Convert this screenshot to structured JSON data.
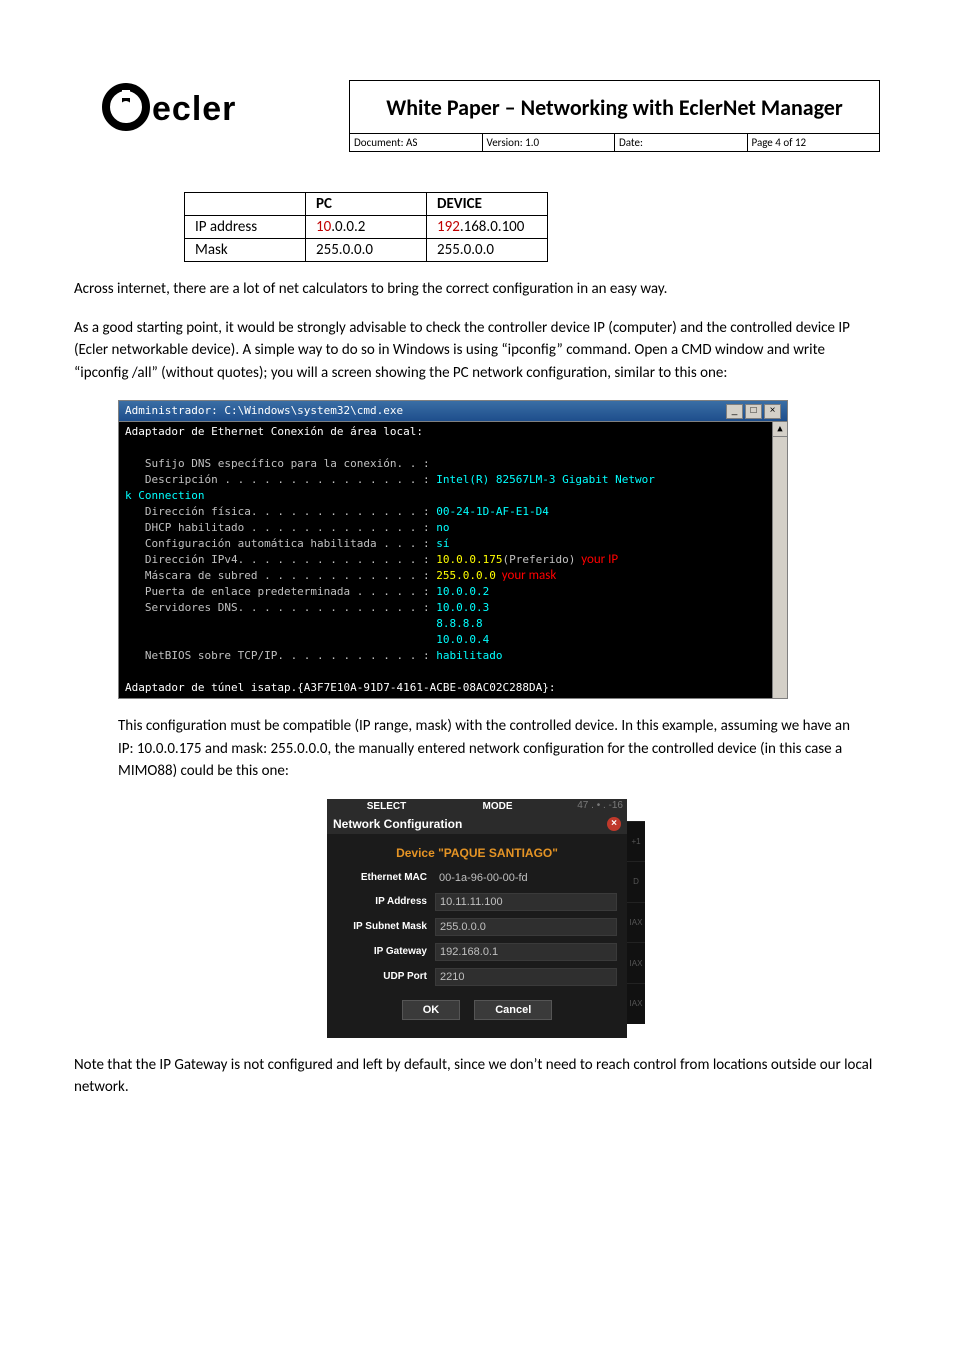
{
  "header": {
    "logo_text": "ecler",
    "title": "White Paper – Networking with EclerNet Manager",
    "meta_doc": "Document:  AS",
    "meta_ver": "Version:  1.0",
    "meta_date": "Date:",
    "meta_page": "Page 4 of 12"
  },
  "ip_table": {
    "h_pc": "PC",
    "h_dev": "DEVICE",
    "r_ip_label": "IP address",
    "r_ip_pc_pre": "10",
    "r_ip_pc_rest": ".0.0.2",
    "r_ip_dev_pre": "192",
    "r_ip_dev_rest": ".168.0.100",
    "r_mask_label": "Mask",
    "r_mask_pc": "255.0.0.0",
    "r_mask_dev": "255.0.0.0"
  },
  "para1": "Across internet, there are a lot of net calculators to bring the correct configuration in an easy way.",
  "para2": "As a good starting point, it would be strongly advisable to check the controller device IP (computer) and the controlled device IP (Ecler networkable device). A simple way to do so in Windows is using “ipconfig” command. Open a CMD window and write “ipconfig /all” (without quotes); you will a screen showing the PC network configuration, similar to this one:",
  "cmd": {
    "title": "Administrador: C:\\Windows\\system32\\cmd.exe",
    "l01": "Adaptador de Ethernet Conexión de área local:",
    "l02": "   Sufijo DNS específico para la conexión. . :",
    "l03a": "   Descripción . . . . . . . . . . . . . . . : ",
    "l03b": "Intel(R) 82567LM-3 Gigabit Networ",
    "l04": "k Connection",
    "l05a": "   Dirección física. . . . . . . . . . . . . : ",
    "l05b": "00-24-1D-AF-E1-D4",
    "l06a": "   DHCP habilitado . . . . . . . . . . . . . : ",
    "l06b": "no",
    "l07a": "   Configuración automática habilitada . . . : ",
    "l07b": "sí",
    "l08a": "   Dirección IPv4. . . . . . . . . . . . . . : ",
    "l08b": "10.0.0.175",
    "l08c": "(Preferido)",
    "l08ann": "  your IP",
    "l09a": "   Máscara de subred . . . . . . . . . . . . : ",
    "l09b": "255.0.0.0",
    "l09ann": "  your mask",
    "l10a": "   Puerta de enlace predeterminada . . . . . : ",
    "l10b": "10.0.0.2",
    "l11a": "   Servidores DNS. . . . . . . . . . . . . . : ",
    "l11b": "10.0.0.3",
    "l12": "                                               8.8.8.8",
    "l13": "                                               10.0.0.4",
    "l14a": "   NetBIOS sobre TCP/IP. . . . . . . . . . . : ",
    "l14b": "habilitado",
    "l15": "Adaptador de túnel isatap.{A3F7E10A-91D7-4161-ACBE-08AC02C288DA}:"
  },
  "para3": "This configuration must be compatible (IP range, mask) with the controlled device. In this example, assuming we have an IP: 10.0.0.175 and mask: 255.0.0.0, the manually entered network configuration for the controlled device (in this case a MIMO88) could be this one:",
  "netcfg": {
    "tab_select": "SELECT",
    "tab_mode": "MODE",
    "tab_right": "47 . • . -16",
    "title": "Network Configuration",
    "device": "Device \"PAQUE SANTIAGO\"",
    "mac_lbl": "Ethernet MAC",
    "mac_val": "00-1a-96-00-00-fd",
    "ip_lbl": "IP Address",
    "ip_val": "10.11.11.100",
    "mask_lbl": "IP Subnet Mask",
    "mask_val": "255.0.0.0",
    "gw_lbl": "IP Gateway",
    "gw_val": "192.168.0.1",
    "udp_lbl": "UDP Port",
    "udp_val": "2210",
    "ok": "OK",
    "cancel": "Cancel",
    "side1": "+1",
    "side2": "D",
    "side3": "IAX",
    "side4": "IAX",
    "side5": "IAX"
  },
  "para4": "Note that the IP Gateway is not configured and left by default, since we don’t need to reach control from locations outside our local network."
}
